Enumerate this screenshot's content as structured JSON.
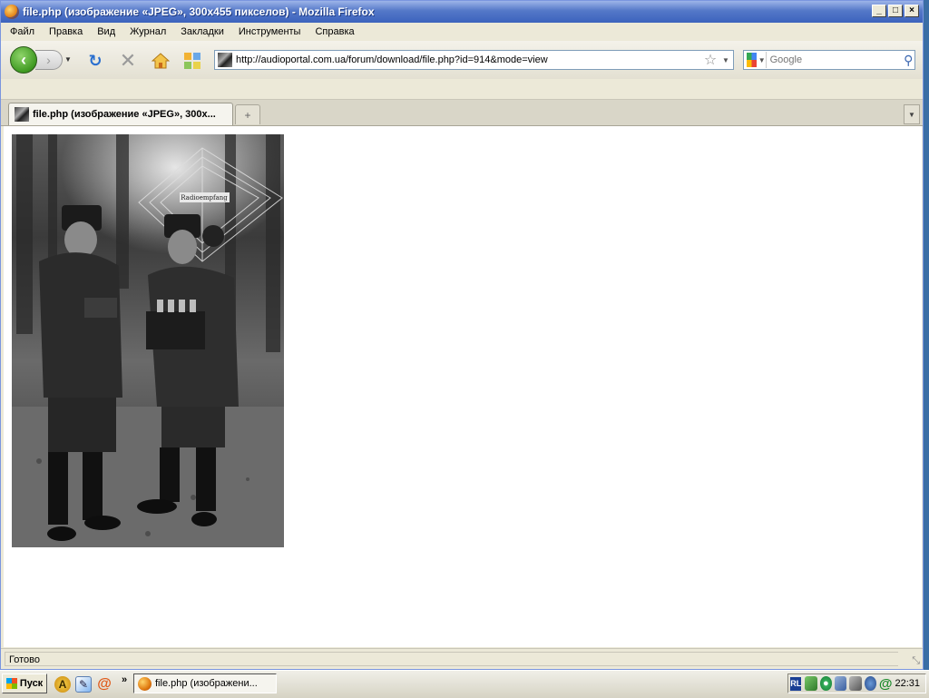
{
  "window": {
    "title": "file.php (изображение «JPEG», 300x455 пикселов) - Mozilla Firefox",
    "buttons": {
      "minimize": "_",
      "maximize": "□",
      "close": "×"
    }
  },
  "menu": {
    "items": [
      "Файл",
      "Правка",
      "Вид",
      "Журнал",
      "Закладки",
      "Инструменты",
      "Справка"
    ]
  },
  "toolbar": {
    "url": "http://audioportal.com.ua/forum/download/file.php?id=914&mode=view",
    "search_placeholder": "Google",
    "icons": {
      "back": "back-arrow-icon",
      "forward": "forward-arrow-icon",
      "reload": "reload-icon",
      "stop": "stop-icon",
      "home": "home-icon",
      "apps": "apps-icon",
      "bookmark_star": "star-icon",
      "search_go": "magnifier-icon"
    }
  },
  "tabs": [
    {
      "label": "file.php (изображение «JPEG», 300x...",
      "active": true
    }
  ],
  "content": {
    "image": {
      "description_visible": false,
      "sign_text": "Radioempfang"
    }
  },
  "statusbar": {
    "text": "Готово"
  },
  "taskbar": {
    "start_label": "Пуск",
    "more_label": "»",
    "task_label": "file.php (изображени...",
    "lang": "RL",
    "clock": "22:31"
  },
  "colors": {
    "titlebar": "#3c63bd",
    "chrome": "#ece9d8",
    "back_button": "#3f9a22",
    "desktop": "#3a6ea5"
  }
}
